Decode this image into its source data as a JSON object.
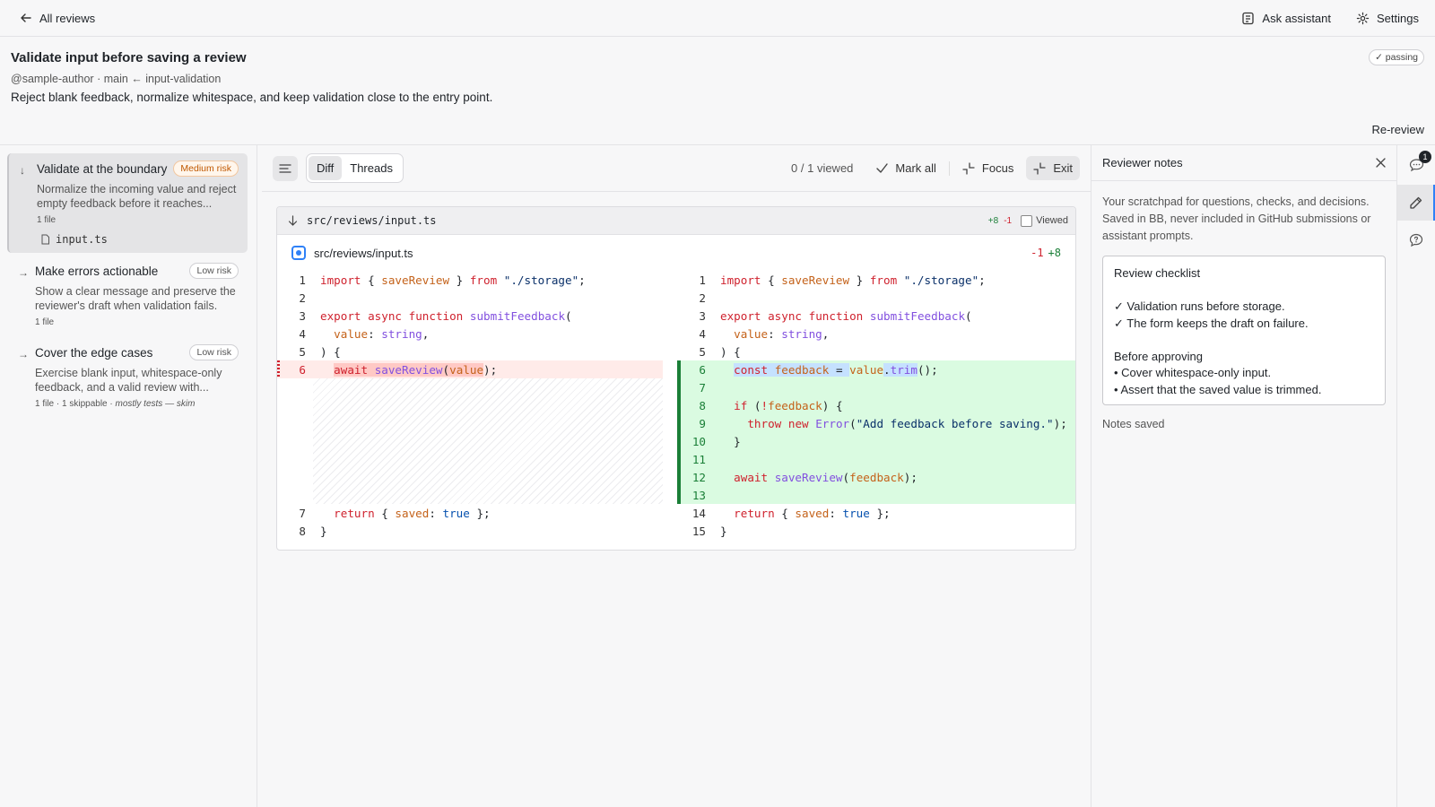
{
  "topbar": {
    "back_label": "All reviews",
    "assistant_label": "Ask assistant",
    "settings_label": "Settings"
  },
  "review": {
    "title": "Validate input before saving a review",
    "meta": "@sample-author · main ← input-validation",
    "description": "Reject blank feedback, normalize whitespace, and keep validation close to the entry point.",
    "status": "✓ passing",
    "rereview_label": "Re-review"
  },
  "steps": [
    {
      "arrow": "↓",
      "title": "Validate at the boundary",
      "risk": "Medium risk",
      "desc": "Normalize the incoming value and reject empty feedback before it reaches...",
      "meta": "1 file",
      "file": "input.ts"
    },
    {
      "arrow": "→",
      "title": "Make errors actionable",
      "risk": "Low risk",
      "desc": "Show a clear message and preserve the reviewer's draft when validation fails.",
      "meta": "1 file"
    },
    {
      "arrow": "→",
      "title": "Cover the edge cases",
      "risk": "Low risk",
      "desc": "Exercise blank input, whitespace-only feedback, and a valid review with...",
      "meta": "1 file  · 1 skippable  · ",
      "meta_note": "mostly tests — skim"
    }
  ],
  "toolbar": {
    "tab_diff": "Diff",
    "tab_threads": "Threads",
    "viewed_count": "0 / 1 viewed",
    "mark_all": "Mark all",
    "focus": "Focus",
    "exit": "Exit"
  },
  "file": {
    "path": "src/reviews/input.ts",
    "additions": "+8",
    "deletions": "-1",
    "viewed_label": "Viewed",
    "sub_path": "src/reviews/input.ts",
    "sub_deletions": "-1",
    "sub_additions": "+8"
  },
  "diff": {
    "left": [
      {
        "n": "1",
        "html": "<span class=\"k\">import</span> { <span class=\"v\">saveReview</span> } <span class=\"k\">from</span> <span class=\"s\">\"./storage\"</span>;"
      },
      {
        "n": "2",
        "html": ""
      },
      {
        "n": "3",
        "html": "<span class=\"k\">export</span> <span class=\"k\">async</span> <span class=\"k\">function</span> <span class=\"f\">submitFeedback</span>("
      },
      {
        "n": "4",
        "html": "  <span class=\"v\">value</span>: <span class=\"f\">string</span>,"
      },
      {
        "n": "5",
        "html": ") {"
      },
      {
        "n": "6",
        "type": "del",
        "html": "  <span class=\"hl-del\"><span class=\"k\">await</span> </span><span class=\"hl-del\"><span class=\"f\">saveReview</span>(</span><span class=\"hl-del\"><span class=\"v\">value</span></span>);"
      },
      {
        "gap": true
      },
      {
        "n": "7",
        "html": "  <span class=\"k\">return</span> { <span class=\"v\">saved</span>: <span class=\"t\">true</span> };"
      },
      {
        "n": "8",
        "html": "}"
      }
    ],
    "right": [
      {
        "n": "1",
        "html": "<span class=\"k\">import</span> { <span class=\"v\">saveReview</span> } <span class=\"k\">from</span> <span class=\"s\">\"./storage\"</span>;"
      },
      {
        "n": "2",
        "html": ""
      },
      {
        "n": "3",
        "html": "<span class=\"k\">export</span> <span class=\"k\">async</span> <span class=\"k\">function</span> <span class=\"f\">submitFeedback</span>("
      },
      {
        "n": "4",
        "html": "  <span class=\"v\">value</span>: <span class=\"f\">string</span>,"
      },
      {
        "n": "5",
        "html": ") {"
      },
      {
        "n": "6",
        "type": "add",
        "html": "  <span class=\"hl-blue\"><span class=\"k\">const</span> <span class=\"v\">feedback</span> = </span><span class=\"v\">value</span><span class=\"hl-blue\">.<span class=\"f\">trim</span></span>();"
      },
      {
        "n": "7",
        "type": "add",
        "html": ""
      },
      {
        "n": "8",
        "type": "add",
        "html": "  <span class=\"k\">if</span> (<span class=\"k\">!</span><span class=\"v\">feedback</span>) {"
      },
      {
        "n": "9",
        "type": "add",
        "html": "    <span class=\"k\">throw</span> <span class=\"k\">new</span> <span class=\"f\">Error</span>(<span class=\"s\">\"Add feedback before saving.\"</span>);"
      },
      {
        "n": "10",
        "type": "add",
        "html": "  }"
      },
      {
        "n": "11",
        "type": "add",
        "html": ""
      },
      {
        "n": "12",
        "type": "add",
        "html": "  <span class=\"k\">await</span> <span class=\"f\">saveReview</span>(<span class=\"v\">feedback</span>);"
      },
      {
        "n": "13",
        "type": "add",
        "html": ""
      },
      {
        "n": "14",
        "html": "  <span class=\"k\">return</span> { <span class=\"v\">saved</span>: <span class=\"t\">true</span> };"
      },
      {
        "n": "15",
        "html": "}"
      }
    ]
  },
  "notes": {
    "title": "Reviewer notes",
    "help": "Your scratchpad for questions, checks, and decisions. Saved in BB, never included in GitHub submissions or assistant prompts.",
    "content": "Review checklist\n\n✓ Validation runs before storage.\n✓ The form keeps the draft on failure.\n\nBefore approving\n• Cover whitespace-only input.\n• Assert that the saved value is trimmed.",
    "status": "Notes saved"
  },
  "rail": {
    "comments_badge": "1"
  },
  "colors": {
    "accent": "#2f81f7",
    "addition": "#1a7f37",
    "deletion": "#cf222e",
    "medium_risk": "#c05800"
  }
}
